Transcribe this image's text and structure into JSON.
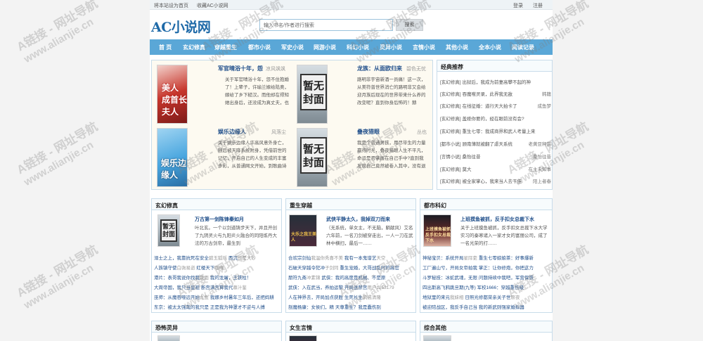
{
  "topbar": {
    "set_home": "将本站设为首页",
    "bookmark": "收藏AC小说网",
    "login": "登录",
    "register": "注册"
  },
  "site": {
    "logo": "AC小说网"
  },
  "search": {
    "placeholder": "输入书名/作者进行搜索",
    "button": "搜索"
  },
  "nav": [
    "首 页",
    "玄幻修真",
    "穿越重生",
    "都市小说",
    "军史小说",
    "网游小说",
    "科幻小说",
    "灵异小说",
    "言情小说",
    "其他小说",
    "全本小说",
    "阅读记录"
  ],
  "featured": [
    {
      "title": "军官晴浴十年，怨",
      "author": "凉风飒飒",
      "desc": "关于军官晴浴十年，怨不住抱婚了！上辈子，许瑜兰嫁给陆奥，嫁给了乡下糙汉。而他却在得知她出身后，还没成为真丈夫，也要为她抛弃一切，和她共渡难关……结局：终于在她最幸福的时候，却遭受了大陆政客太太，痛后乡下",
      "cover": "美人 成首长夫人"
    },
    {
      "title": "龙族：从面欧归来",
      "author": "碧色无忧",
      "desc": "路明非宇宙新酒一员痛！这一次，从美符普世界消亡的路明非又会给迎月族后现在的世界带来什么养的改变呢？直到你身后怖的！赫",
      "cover": "暂无封面"
    },
    {
      "title": "娱乐边缘人",
      "author": "风落尘",
      "desc": "关于娱乐边缘人许高风意外身亡，随后被天降系统附身，凭借前世的记忆，开启自己的人生变成的丰富多彩，从普通网文开始，到歌曲诗词影视",
      "cover": "娱乐边缘人"
    },
    {
      "title": "叠夜猎眼",
      "author": "丛也",
      "desc": "我是个普通男孩，用尽毕生的力量赢得时光，叠夜猎眼人生不平凡，命运是否掌握在自己手中?直到我发现自己竟然被卷入其中，没有退路，只能一条走到底我的道路。抓",
      "cover": "暂无封面"
    }
  ],
  "recommend": {
    "title": "经典推荐",
    "items": [
      {
        "cat": "[玄幻修真]",
        "name": "出狱后，我成为前妻高攀不起的神",
        "author": ""
      },
      {
        "cat": "[玄幻修真]",
        "name": "吞魔噬灵录，此界我无敌",
        "author": "韩籍"
      },
      {
        "cat": "[玄幻修真]",
        "name": "在线征婚：道行天大拍卡了",
        "author": "成鱼梦"
      },
      {
        "cat": "[玄幻修真]",
        "name": "盖娅你要的，经在眼前没有会?",
        "author": ""
      },
      {
        "cat": "[玄幻修真]",
        "name": "重生七零：我成商界和武人考量上来",
        "author": ""
      },
      {
        "cat": "[都市小说]",
        "name": "顾南薄就被翻了虐天系统",
        "author": "老黄豆秤前"
      },
      {
        "cat": "[言情小说]",
        "name": "桑怡往昔",
        "author": "桑怡往昔"
      },
      {
        "cat": "[玄幻修真]",
        "name": "莫大",
        "author": "在主未知事"
      },
      {
        "cat": "[玄幻修真]",
        "name": "被全家掌心，我来当人去干佳",
        "author": "阳上者春"
      }
    ]
  },
  "categories": [
    {
      "title": "玄幻修真",
      "top": {
        "title": "万古第一剑陈锋秦如月",
        "desc": "叶北玄。一个以剑道铸步天下，并且开创了九阴灵火与九阳炎火融合的同阳炼丹大法的万古剑帝，最生到",
        "cover": "暂无封面"
      },
      "rows": [
        {
          "a": "溺士之上，我靠抗死在安全",
          "b": "碧玉狐瑶",
          "c": "西沉",
          "d": "只是大砂"
        },
        {
          "a": "人族镇守使",
          "b": "白驹易逝",
          "c": "红楼天下",
          "d": "咖喱"
        },
        {
          "a": "港片：表哥我说你找我",
          "b": "我面",
          "c": "我的龙屠，王铁柱！",
          "d": ""
        },
        {
          "a": "大周帝国，我只当皇祖",
          "b": "",
          "c": "断宫满宫算我代",
          "d": "慕汁鉴"
        },
        {
          "a": "巫师：从魔吞噬远开始",
          "b": "九鱼",
          "c": "我娜乡村暑年三年后，还把妈耕",
          "d": ""
        },
        {
          "a": "东京：被太太强哉的我只是",
          "b": "",
          "c": "正是我为神罩才不逆与人搏",
          "d": ""
        }
      ]
    },
    {
      "title": "重生穿越",
      "top": {
        "title": "武侠平静太久，我掉双刀而来",
        "desc": "（无系统，单女主，不无脑，躺献风）艾名六年前，一名刀剑被穿走出，一人一刀在武林中横扫，最后一……",
        "cover": "大乐之我王美人"
      },
      "rows": [
        {
          "a": "合欢宗剑仙",
          "b": "我温你秀喜不美",
          "c": "我有一本鬼谱艺",
          "d": "天空"
        },
        {
          "a": "石破天穿越令犯冲",
          "b": "子剑同",
          "c": "重生宠婚，大哥战乱时的高官",
          "d": ""
        },
        {
          "a": "朋符九斋",
          "b": "冲素锦",
          "c": "武侠：我的高度是机械、不是原",
          "d": ""
        },
        {
          "a": "武侠：入在武当，养拍运黎",
          "b": "",
          "c": "开局送禁宫",
          "d": "用户1253179"
        },
        {
          "a": "人在神界去，开局加点获胜",
          "b": "",
          "c": "生死长生",
          "d": "风高清隆"
        },
        {
          "a": "剖魔杨康：女侯们，精",
          "b": "",
          "c": "天尊重生？我是蠢伤别",
          "d": ""
        }
      ]
    },
    {
      "title": "都市科幻",
      "top": {
        "title": "上班摸鱼被抓，反手扣女总裁下水",
        "desc": "关于上班摸鱼被抓，反手扣女总裁下水大学实习的秦寒诸入一家才女的富丽公司，成了一名光荣的打……",
        "cover": "上班摸鱼被抓 反手扣女总裁下水"
      },
      "rows": [
        {
          "a": "神秘宝贝：系统开局",
          "b": "星际吏",
          "c": "重生七零娘娘茶：好事爆新",
          "d": ""
        },
        {
          "a": "工厂遍山兮，开局女帝拍我",
          "b": "",
          "c": "掌正：让你修炮，你把这力",
          "d": ""
        },
        {
          "a": "斗罗秘技：冰蛇武魂，无限",
          "b": "",
          "c": "问题持续中我吧，军营保铁",
          "d": ""
        },
        {
          "a": "四出斯高飞鸦跳旦期(九等)",
          "b": "",
          "c": "军校1666：穿越重伤级",
          "d": ""
        },
        {
          "a": "地狱里的来元",
          "b": "我妹相",
          "c": "日照光修都荣亲关子世",
          "d": "原夜"
        },
        {
          "a": "被迎陪战区，我反手自己当",
          "b": "",
          "c": "我的新武则强家婚拟器",
          "d": ""
        }
      ]
    }
  ],
  "bottom": [
    "恐怖灵异",
    "女生言情",
    "综合其他"
  ],
  "watermarks": [
    "A链接 - 网址导航",
    "www.alianjie.cn"
  ]
}
